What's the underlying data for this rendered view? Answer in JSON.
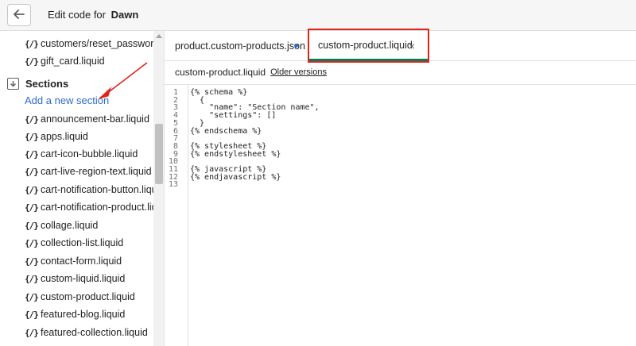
{
  "header": {
    "title_prefix": "Edit code for",
    "theme_name": "Dawn",
    "back_icon": "arrow-left-icon"
  },
  "sidebar": {
    "files_above": [
      {
        "icon": "{/}",
        "name": "customers/reset_password.liquid"
      },
      {
        "icon": "{/}",
        "name": "gift_card.liquid"
      }
    ],
    "section_label": "Sections",
    "add_link": "Add a new section",
    "section_files": [
      {
        "icon": "{/}",
        "name": "announcement-bar.liquid"
      },
      {
        "icon": "{/}",
        "name": "apps.liquid"
      },
      {
        "icon": "{/}",
        "name": "cart-icon-bubble.liquid"
      },
      {
        "icon": "{/}",
        "name": "cart-live-region-text.liquid"
      },
      {
        "icon": "{/}",
        "name": "cart-notification-button.liquid"
      },
      {
        "icon": "{/}",
        "name": "cart-notification-product.liquid"
      },
      {
        "icon": "{/}",
        "name": "collage.liquid"
      },
      {
        "icon": "{/}",
        "name": "collection-list.liquid"
      },
      {
        "icon": "{/}",
        "name": "contact-form.liquid"
      },
      {
        "icon": "{/}",
        "name": "custom-liquid.liquid"
      },
      {
        "icon": "{/}",
        "name": "custom-product.liquid"
      },
      {
        "icon": "{/}",
        "name": "featured-blog.liquid"
      },
      {
        "icon": "{/}",
        "name": "featured-collection.liquid"
      }
    ]
  },
  "tabs": [
    {
      "label": "product.custom-products.json",
      "unsaved": true
    },
    {
      "label": "custom-product.liquid",
      "active": true,
      "close": "×"
    }
  ],
  "editor": {
    "file_name": "custom-product.liquid",
    "older_versions": "Older versions",
    "lines": [
      "{% schema %}",
      "  {",
      "    \"name\": \"Section name\",",
      "    \"settings\": []",
      "  }",
      "{% endschema %}",
      "",
      "{% stylesheet %}",
      "{% endstylesheet %}",
      "",
      "{% javascript %}",
      "{% endjavascript %}",
      ""
    ]
  },
  "colors": {
    "link": "#2c6ecb",
    "active_tab": "#008060",
    "annotation": "#e2231a"
  }
}
